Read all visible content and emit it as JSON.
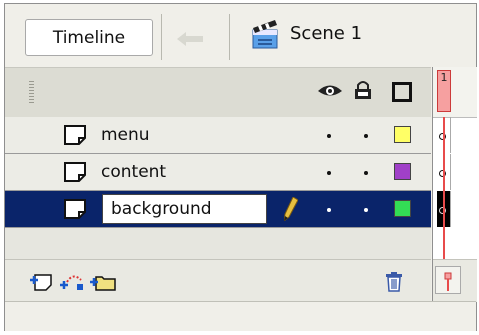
{
  "tabs": {
    "timeline_label": "Timeline"
  },
  "scene": {
    "label": "Scene 1"
  },
  "ruler": {
    "frame_number": "1"
  },
  "layers": [
    {
      "name": "menu",
      "color": "#ffff66"
    },
    {
      "name": "content",
      "color": "#a040c8"
    },
    {
      "name": "background",
      "color": "#33dd55",
      "selected": true
    }
  ],
  "colors": {
    "selection": "#0a246a",
    "playhead": "#e84b4b"
  }
}
